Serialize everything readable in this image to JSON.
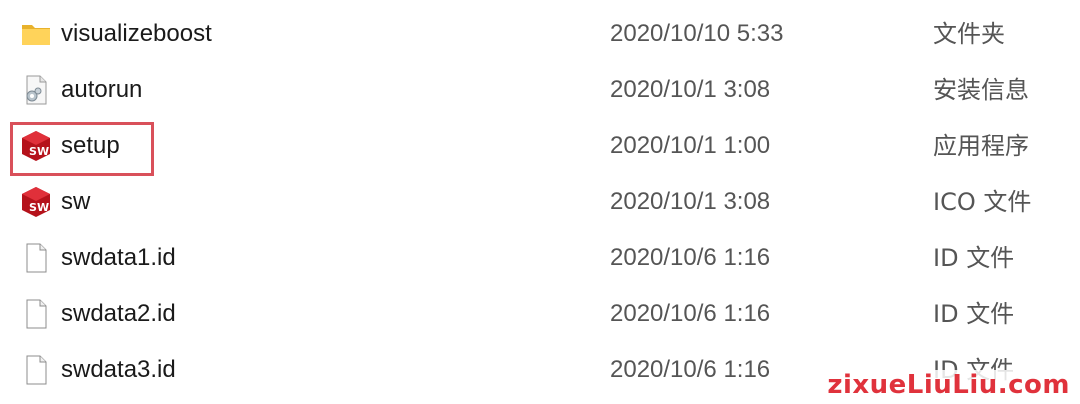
{
  "files": [
    {
      "name": "visualizeboost",
      "date": "2020/10/10 5:33",
      "type": "文件夹",
      "icon": "folder-icon"
    },
    {
      "name": "autorun",
      "date": "2020/10/1 3:08",
      "type": "安装信息",
      "icon": "settings-file-icon"
    },
    {
      "name": "setup",
      "date": "2020/10/1 1:00",
      "type": "应用程序",
      "icon": "solidworks-app-icon"
    },
    {
      "name": "sw",
      "date": "2020/10/1 3:08",
      "type": "ICO 文件",
      "icon": "solidworks-app-icon"
    },
    {
      "name": "swdata1.id",
      "date": "2020/10/6 1:16",
      "type": "ID 文件",
      "icon": "blank-file-icon"
    },
    {
      "name": "swdata2.id",
      "date": "2020/10/6 1:16",
      "type": "ID 文件",
      "icon": "blank-file-icon"
    },
    {
      "name": "swdata3.id",
      "date": "2020/10/6 1:16",
      "type": "ID 文件",
      "icon": "blank-file-icon"
    }
  ],
  "highlight_color": "#d9505a",
  "watermark": "zixueLiuLiu.com",
  "watermark_color": "#e0323c"
}
